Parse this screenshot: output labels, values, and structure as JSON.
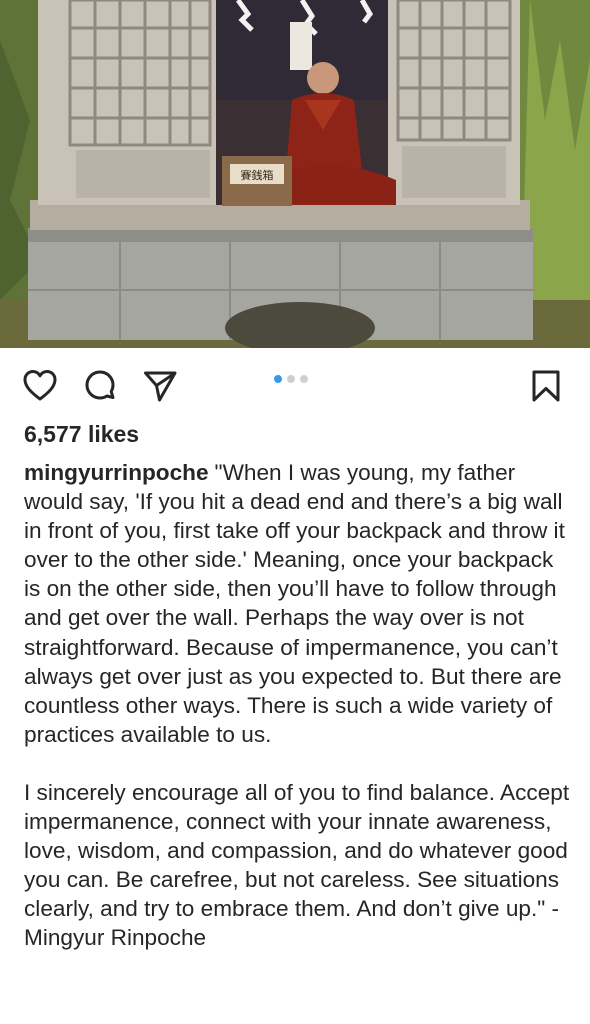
{
  "post": {
    "image_alt": "Monk in red robes seated inside a small wooden shrine",
    "likes_text": "6,577 likes",
    "username": "mingyurrinpoche",
    "caption_paragraph_1": "\"When I was young, my father would say, 'If you hit a dead end and there’s a big wall in front of you, first take off your backpack and throw it over to the other side.' Meaning, once your backpack is on the other side, then you’ll have to follow through and get over the wall. Perhaps the way over is not straightforward. Because of impermanence, you can’t always get over just as you expected to. But there are countless other ways. There is such a wide variety of practices available to us.",
    "caption_paragraph_2": "I sincerely encourage all of you to find balance. Accept impermanence, connect with your innate awareness, love, wisdom, and compassion, and do whatever good you can. Be carefree, but not careless. See situations clearly, and try to embrace them. And don’t give up.\" - Mingyur Rinpoche",
    "carousel": {
      "total": 3,
      "active_index": 1
    }
  },
  "icons": {
    "like": "heart-icon",
    "comment": "comment-bubble-icon",
    "share": "paper-plane-icon",
    "save": "bookmark-icon"
  },
  "colors": {
    "text": "#262626",
    "carousel_active": "#3897f0",
    "carousel_inactive": "#cfcfcf"
  }
}
